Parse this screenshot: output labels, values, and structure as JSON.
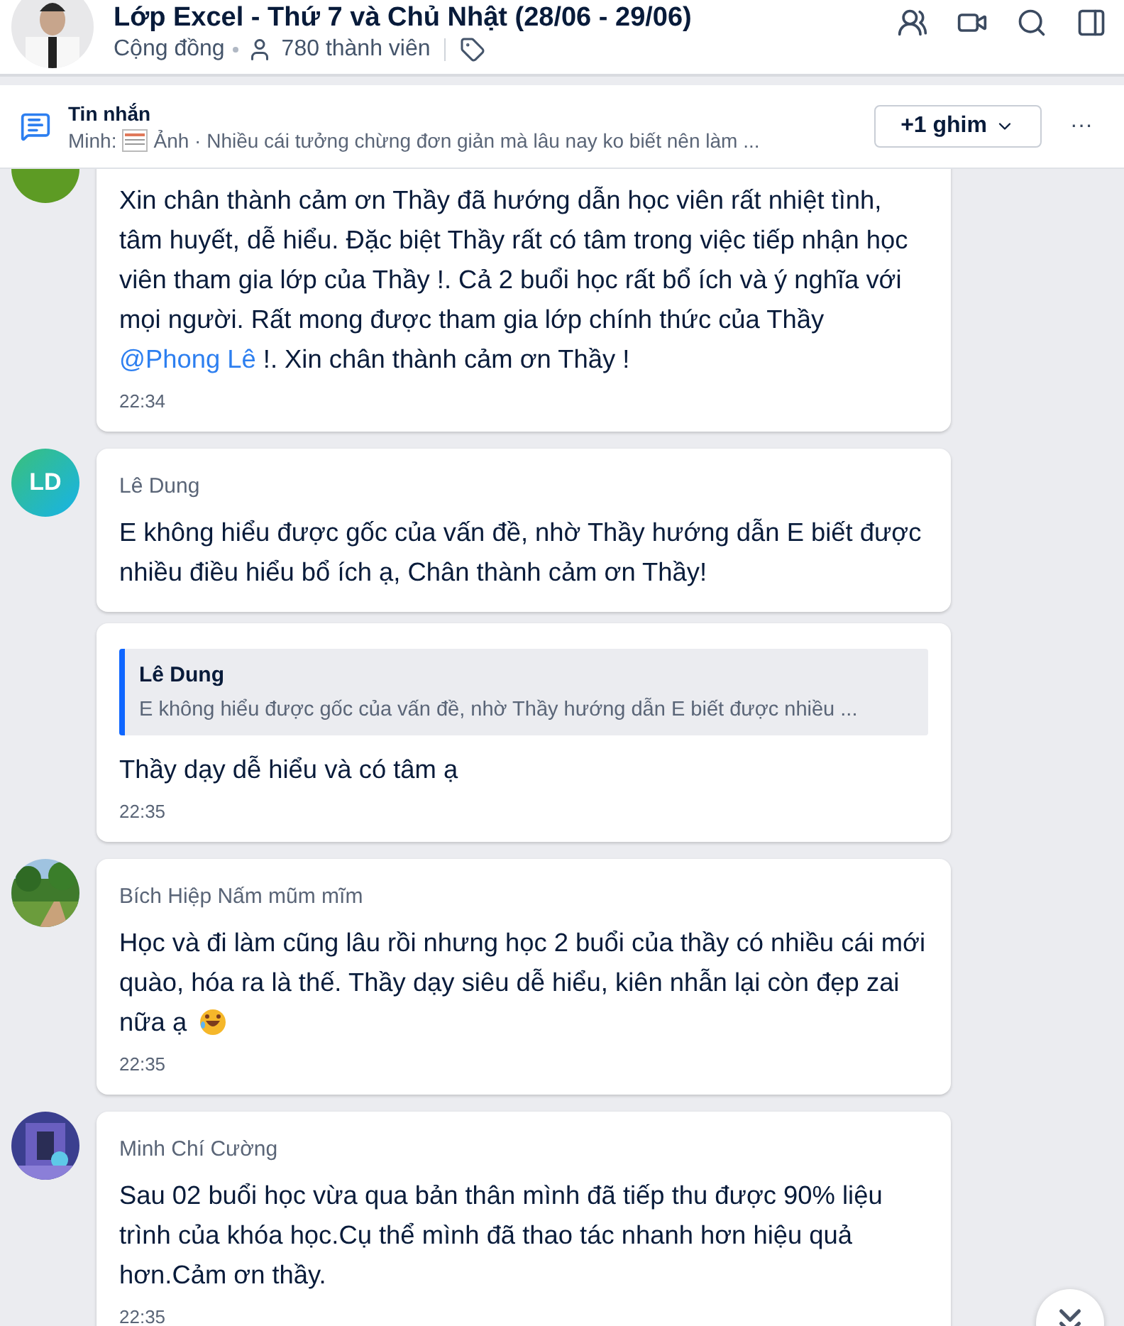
{
  "header": {
    "title": "Lớp Excel - Thứ 7 và Chủ Nhật (28/06 - 29/06)",
    "community": "Cộng đồng",
    "members": "780 thành viên"
  },
  "pinned": {
    "title": "Tin nhắn",
    "sender": "Minh:",
    "has_thumbnail": true,
    "preview": "Ảnh · Nhiều cái tưởng chừng đơn giản mà lâu nay ko biết nên làm ...",
    "button": "+1 ghim",
    "more": "···"
  },
  "groups": [
    {
      "avatar": {
        "kind": "disc"
      },
      "cut": true,
      "bubbles": [
        {
          "kind": "text",
          "parts": [
            {
              "kind": "plain",
              "text": "Xin chân thành cảm ơn Thầy đã hướng dẫn học viên rất nhiệt tình, tâm huyết, dễ hiểu. Đặc biệt Thầy rất có tâm trong việc tiếp nhận học viên tham gia lớp của  Thầy !.  Cả 2 buổi học rất bổ ích và ý nghĩa với mọi người. Rất mong được tham gia lớp chính thức của Thầy "
            },
            {
              "kind": "mention",
              "text": "@Phong Lê"
            },
            {
              "kind": "plain",
              "text": "  !. Xin chân thành cảm ơn Thầy !"
            }
          ],
          "time": "22:34"
        }
      ]
    },
    {
      "avatar": {
        "kind": "initials",
        "text": "LD"
      },
      "cut": false,
      "bubbles": [
        {
          "kind": "text",
          "sender": "Lê Dung",
          "parts": [
            {
              "kind": "plain",
              "text": "E không hiểu được gốc của vấn đề, nhờ Thầy hướng dẫn E biết được nhiều điều hiểu bổ ích ạ, Chân thành cảm ơn Thầy!"
            }
          ]
        },
        {
          "kind": "reply",
          "quote": {
            "sender": "Lê Dung",
            "text": "E không hiểu được gốc của vấn đề, nhờ Thầy hướng dẫn E biết được nhiều ..."
          },
          "parts": [
            {
              "kind": "plain",
              "text": "Thầy dạy dễ hiểu và có tâm ạ"
            }
          ],
          "time": "22:35"
        }
      ]
    },
    {
      "avatar": {
        "kind": "picture"
      },
      "cut": false,
      "bubbles": [
        {
          "kind": "text",
          "sender": "Bích Hiệp Nấm mũm mĩm",
          "parts": [
            {
              "kind": "plain",
              "text": "Học và đi làm cũng lâu rồi nhưng học 2 buổi của thầy có nhiều cái mới quào, hóa ra là thế. Thầy dạy siêu dễ hiểu, kiên nhẫn lại còn đẹp zai nữa ạ"
            },
            {
              "kind": "emoji"
            }
          ],
          "time": "22:35"
        }
      ]
    },
    {
      "avatar": {
        "kind": "picture"
      },
      "cut": false,
      "bubbles": [
        {
          "kind": "text",
          "sender": "Minh Chí Cường",
          "parts": [
            {
              "kind": "plain",
              "text": "Sau 02 buổi học vừa qua bản thân mình đã tiếp thu được 90% liệu trình của khóa học.Cụ thể mình đã thao tác nhanh hơn hiệu quả hơn.Cảm ơn thầy."
            }
          ],
          "time": "22:35"
        }
      ]
    }
  ]
}
